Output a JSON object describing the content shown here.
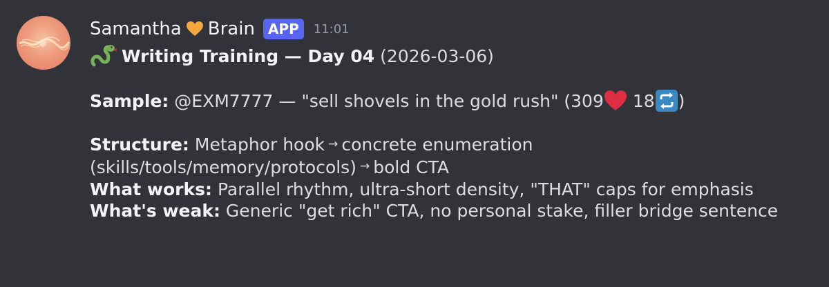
{
  "message": {
    "author": {
      "name_part1": "Samantha",
      "name_heart_icon": "orange-heart-icon",
      "name_part2": "Brain",
      "badge": "APP",
      "timestamp": "11:01"
    },
    "title": {
      "icon": "snake-icon",
      "bold_text": "Writing Training — Day 04",
      "date": "(2026-03-06)"
    },
    "sample": {
      "label": "Sample:",
      "mention": "@EXM7777",
      "text": " — \"sell shovels in the gold rush\" (",
      "likes": "309",
      "likes_icon": "red-heart-icon",
      "reposts": " 18",
      "reposts_icon": "repeat-icon",
      "close": ")"
    },
    "structure": {
      "label": "Structure:",
      "part1": " Metaphor hook",
      "arrow": "→",
      "part2": "concrete enumeration",
      "line2_part1": "(skills/tools/memory/protocols)",
      "line2_part2": "bold CTA"
    },
    "works": {
      "label": "What works:",
      "text": " Parallel rhythm, ultra-short density, \"THAT\" caps for emphasis"
    },
    "weak": {
      "label": "What's weak:",
      "text": " Generic \"get rich\" CTA, no personal stake, filler bridge sentence"
    }
  },
  "colors": {
    "background": "#313338",
    "text": "#dbdee1",
    "badge": "#5865f2",
    "timestamp": "#949ba4"
  }
}
